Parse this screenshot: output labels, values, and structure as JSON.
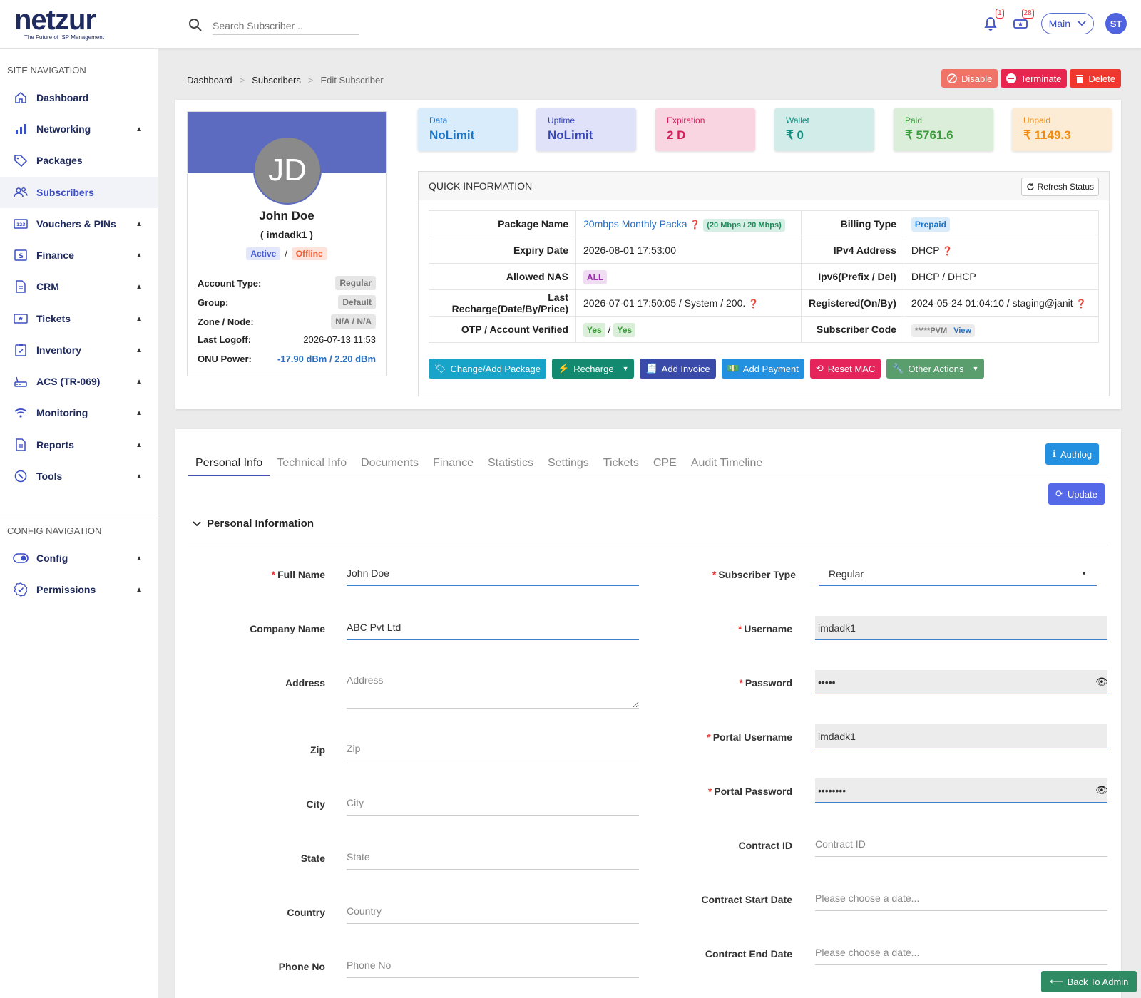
{
  "app": {
    "logo": "netzur",
    "tagline": "The Future of ISP Management"
  },
  "search": {
    "placeholder": "Search Subscriber .."
  },
  "topbar": {
    "notif_count": "1",
    "ticket_count": "28",
    "main_label": "Main",
    "avatar": "ST"
  },
  "sidebar": {
    "site_heading": "SITE NAVIGATION",
    "config_heading": "CONFIG NAVIGATION",
    "items": [
      {
        "label": "Dashboard"
      },
      {
        "label": "Networking"
      },
      {
        "label": "Packages"
      },
      {
        "label": "Subscribers"
      },
      {
        "label": "Vouchers & PINs"
      },
      {
        "label": "Finance"
      },
      {
        "label": "CRM"
      },
      {
        "label": "Tickets"
      },
      {
        "label": "Inventory"
      },
      {
        "label": "ACS (TR-069)"
      },
      {
        "label": "Monitoring"
      },
      {
        "label": "Reports"
      },
      {
        "label": "Tools"
      }
    ],
    "config_items": [
      {
        "label": "Config"
      },
      {
        "label": "Permissions"
      }
    ]
  },
  "breadcrumb": {
    "items": [
      "Dashboard",
      "Subscribers",
      "Edit Subscriber"
    ],
    "sep": ">"
  },
  "actions": {
    "disable": "Disable",
    "terminate": "Terminate",
    "delete": "Delete"
  },
  "profile": {
    "initials": "JD",
    "name": "John Doe",
    "username": "( imdadk1 )",
    "status_active": "Active",
    "status_sep": "/",
    "status_offline": "Offline",
    "rows": [
      {
        "k": "Account Type:",
        "v": "Regular"
      },
      {
        "k": "Group:",
        "v": "Default"
      },
      {
        "k": "Zone / Node:",
        "v": "N/A / N/A"
      },
      {
        "k": "Last Logoff:",
        "v": "2026-07-13 11:53"
      },
      {
        "k": "ONU Power:",
        "v": "-17.90 dBm / 2.20 dBm"
      }
    ]
  },
  "stats": [
    {
      "label": "Data",
      "value": "NoLimit"
    },
    {
      "label": "Uptime",
      "value": "NoLimit"
    },
    {
      "label": "Expiration",
      "value": "2 D"
    },
    {
      "label": "Wallet",
      "value": "₹ 0"
    },
    {
      "label": "Paid",
      "value": "₹ 5761.6"
    },
    {
      "label": "Unpaid",
      "value": "₹ 1149.3"
    }
  ],
  "quick": {
    "title": "QUICK INFORMATION",
    "refresh": "Refresh Status",
    "package_name_k": "Package Name",
    "package_name_v": "20mbps Monthly Packa",
    "package_speed": "(20 Mbps / 20 Mbps)",
    "billing_type_k": "Billing Type",
    "billing_type_v": "Prepaid",
    "expiry_k": "Expiry Date",
    "expiry_v": "2026-08-01 17:53:00",
    "ipv4_k": "IPv4 Address",
    "ipv4_v": "DHCP",
    "nas_k": "Allowed NAS",
    "nas_v": "ALL",
    "ipv6_k": "Ipv6(Prefix / Del)",
    "ipv6_v": "DHCP / DHCP",
    "recharge_k": "Last Recharge(Date/By/Price)",
    "recharge_v": "2026-07-01 17:50:05 / System / 200.",
    "registered_k": "Registered(On/By)",
    "registered_v": "2024-05-24 01:04:10 / staging@janit",
    "otp_k": "OTP / Account Verified",
    "otp_v1": "Yes",
    "otp_sep": "/",
    "otp_v2": "Yes",
    "code_k": "Subscriber Code",
    "code_v": "*****PVM",
    "code_view": "View",
    "buttons": {
      "change_pkg": "Change/Add Package",
      "recharge": "Recharge",
      "add_invoice": "Add Invoice",
      "add_payment": "Add Payment",
      "reset_mac": "Reset MAC",
      "other": "Other Actions"
    }
  },
  "tabs": [
    "Personal Info",
    "Technical Info",
    "Documents",
    "Finance",
    "Statistics",
    "Settings",
    "Tickets",
    "CPE",
    "Audit Timeline"
  ],
  "authlog": "Authlog",
  "update": "Update",
  "section_title": "Personal Information",
  "form": {
    "full_name": {
      "label": "Full Name",
      "value": "John Doe"
    },
    "company": {
      "label": "Company Name",
      "value": "ABC Pvt Ltd"
    },
    "address": {
      "label": "Address",
      "placeholder": "Address"
    },
    "zip": {
      "label": "Zip",
      "placeholder": "Zip"
    },
    "city": {
      "label": "City",
      "placeholder": "City"
    },
    "state": {
      "label": "State",
      "placeholder": "State"
    },
    "country": {
      "label": "Country",
      "placeholder": "Country"
    },
    "phone": {
      "label": "Phone No",
      "placeholder": "Phone No"
    },
    "sub_type": {
      "label": "Subscriber Type",
      "value": "Regular"
    },
    "username": {
      "label": "Username",
      "value": "imdadk1"
    },
    "password": {
      "label": "Password",
      "value": "•••••"
    },
    "portal_username": {
      "label": "Portal Username",
      "value": "imdadk1"
    },
    "portal_password": {
      "label": "Portal Password",
      "value": "••••••••"
    },
    "contract_id": {
      "label": "Contract ID",
      "placeholder": "Contract ID"
    },
    "contract_start": {
      "label": "Contract Start Date",
      "placeholder": "Please choose a date..."
    },
    "contract_end": {
      "label": "Contract End Date",
      "placeholder": "Please choose a date..."
    }
  },
  "back": "Back To Admin"
}
